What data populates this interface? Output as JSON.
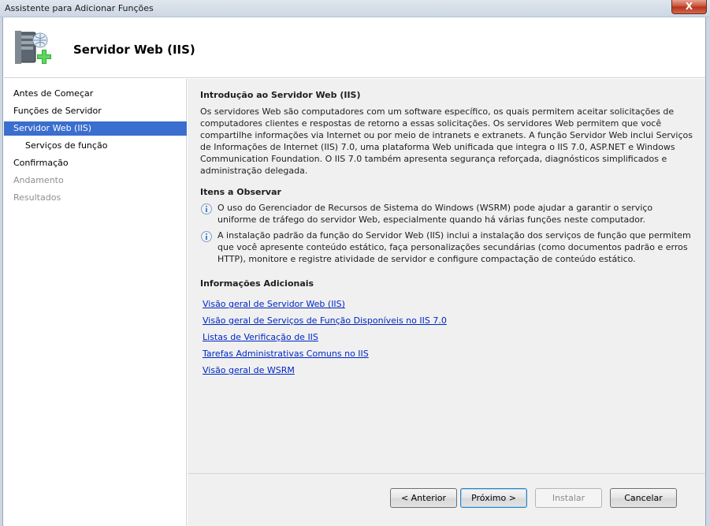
{
  "window": {
    "title": "Assistente para Adicionar Funções",
    "close_label": "X"
  },
  "header": {
    "title": "Servidor Web (IIS)"
  },
  "nav": {
    "items": [
      {
        "label": "Antes de Começar",
        "state": "normal"
      },
      {
        "label": "Funções de Servidor",
        "state": "normal"
      },
      {
        "label": "Servidor Web (IIS)",
        "state": "active"
      },
      {
        "label": "Serviços de função",
        "state": "sub"
      },
      {
        "label": "Confirmação",
        "state": "normal"
      },
      {
        "label": "Andamento",
        "state": "disabled"
      },
      {
        "label": "Resultados",
        "state": "disabled"
      }
    ]
  },
  "main": {
    "intro_title": "Introdução ao Servidor Web (IIS)",
    "intro_text": "Os servidores Web são computadores com um software específico, os quais permitem aceitar solicitações de computadores clientes e respostas de retorno a essas solicitações. Os servidores Web permitem que você compartilhe informações via Internet ou por meio de intranets e extranets. A função Servidor Web inclui Serviços de Informações de Internet (IIS) 7.0, uma plataforma Web unificada que integra o IIS 7.0, ASP.NET e Windows Communication Foundation. O IIS 7.0 também apresenta segurança reforçada, diagnósticos simplificados e administração delegada.",
    "notes_title": "Itens a Observar",
    "notes": [
      "O uso do Gerenciador de Recursos de Sistema do Windows (WSRM) pode ajudar a garantir o serviço uniforme de tráfego do servidor Web, especialmente quando há várias funções neste computador.",
      "A instalação padrão da função do Servidor Web (IIS) inclui a instalação dos serviços de função que permitem que você apresente conteúdo estático, faça personalizações secundárias (como documentos padrão e erros HTTP), monitore e registre atividade de servidor e configure compactação de conteúdo estático."
    ],
    "more_title": "Informações Adicionais",
    "links": [
      "Visão geral de Servidor Web (IIS)",
      "Visão geral de Serviços de Função Disponíveis no IIS 7.0",
      "Listas de Verificação de IIS",
      "Tarefas Administrativas Comuns no IIS",
      "Visão geral de WSRM"
    ]
  },
  "buttons": {
    "back": "< Anterior",
    "next": "Próximo >",
    "install": "Instalar",
    "cancel": "Cancelar"
  },
  "colors": {
    "nav_active": "#3a6ecf",
    "link": "#0026c4"
  }
}
